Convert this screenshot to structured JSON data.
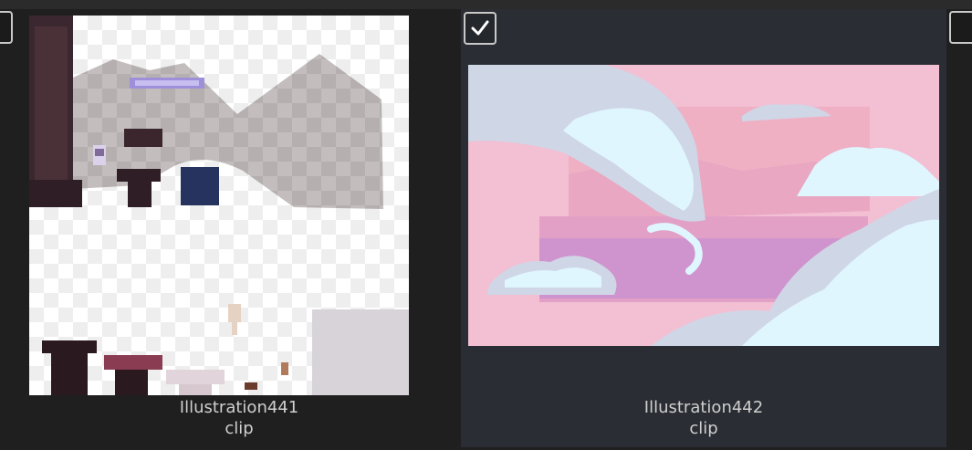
{
  "items": [
    {
      "name": "Illustration441",
      "type": "clip",
      "selected": false
    },
    {
      "name": "Illustration442",
      "type": "clip",
      "selected": true
    }
  ],
  "icons": {
    "checkmark": "checkmark-icon"
  },
  "colors": {
    "selected_card_bg": "#2a2d33",
    "background": "#1f1f1f",
    "caption": "#cfcfcf"
  }
}
